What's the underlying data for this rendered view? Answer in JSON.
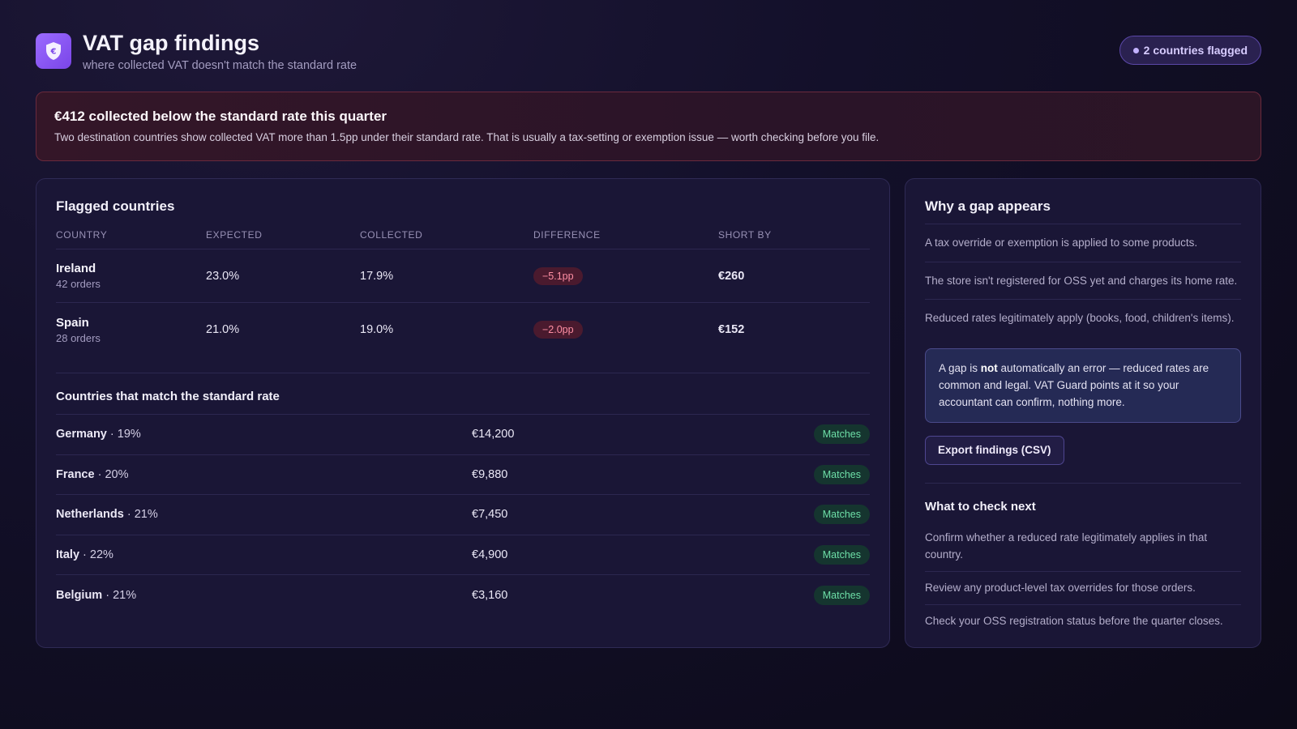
{
  "header": {
    "title": "VAT gap findings",
    "subtitle": "where collected VAT doesn't match the standard rate",
    "flag_badge": "2 countries flagged",
    "logo_icon": "shield-euro-icon"
  },
  "alert": {
    "title": "€412 collected below the standard rate this quarter",
    "text": "Two destination countries show collected VAT more than 1.5pp under their standard rate. That is usually a tax-setting or exemption issue — worth checking before you file."
  },
  "flagged": {
    "title": "Flagged countries",
    "columns": [
      "COUNTRY",
      "EXPECTED",
      "COLLECTED",
      "DIFFERENCE",
      "SHORT BY"
    ],
    "rows": [
      {
        "country": "Ireland",
        "orders": "42 orders",
        "expected": "23.0%",
        "collected": "17.9%",
        "difference": "−5.1pp",
        "short_by": "€260"
      },
      {
        "country": "Spain",
        "orders": "28 orders",
        "expected": "21.0%",
        "collected": "19.0%",
        "difference": "−2.0pp",
        "short_by": "€152"
      }
    ]
  },
  "matching": {
    "title": "Countries that match the standard rate",
    "rows": [
      {
        "country": "Germany",
        "rate": " · 19%",
        "amount": "€14,200",
        "status": "Matches"
      },
      {
        "country": "France",
        "rate": " · 20%",
        "amount": "€9,880",
        "status": "Matches"
      },
      {
        "country": "Netherlands",
        "rate": " · 21%",
        "amount": "€7,450",
        "status": "Matches"
      },
      {
        "country": "Italy",
        "rate": " · 22%",
        "amount": "€4,900",
        "status": "Matches"
      },
      {
        "country": "Belgium",
        "rate": " · 21%",
        "amount": "€3,160",
        "status": "Matches"
      }
    ]
  },
  "side": {
    "title": "Why a gap appears",
    "reasons": [
      "A tax override or exemption is applied to some products.",
      "The store isn't registered for OSS yet and charges its home rate.",
      "Reduced rates legitimately apply (books, food, children's items)."
    ],
    "note_prefix": "A gap is ",
    "note_bold": "not",
    "note_suffix": " automatically an error — reduced rates are common and legal. VAT Guard points at it so your accountant can confirm, nothing more.",
    "export_label": "Export findings (CSV)",
    "next_title": "What to check next",
    "checks": [
      "Confirm whether a reduced rate legitimately applies in that country.",
      "Review any product-level tax overrides for those orders.",
      "Check your OSS registration status before the quarter closes."
    ]
  },
  "colors": {
    "accent": "#8b5cf6",
    "danger": "#ff8fa4",
    "success": "#6ee0a8"
  }
}
